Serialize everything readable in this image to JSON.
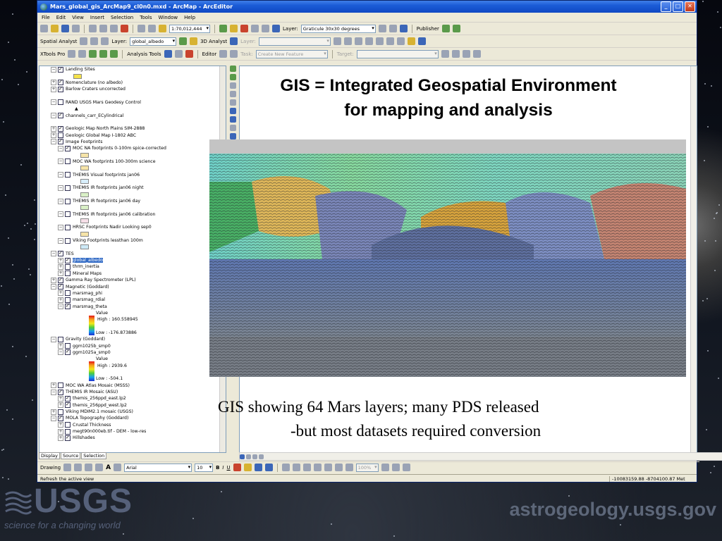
{
  "window": {
    "title": "Mars_global_gis_ArcMap9_cl0n0.mxd - ArcMap - ArcEditor",
    "controls": [
      "_",
      "□",
      "✕"
    ]
  },
  "menu": [
    "File",
    "Edit",
    "View",
    "Insert",
    "Selection",
    "Tools",
    "Window",
    "Help"
  ],
  "standard_toolbar": {
    "scale": "1:70,012,444",
    "layer_label": "Layer:",
    "layer_value": "Graticule 30x30 degrees",
    "publisher": "Publisher"
  },
  "analysis_toolbar": {
    "spatial_analyst": "Spatial Analyst",
    "layer_label": "Layer:",
    "layer_value": "global_albedo",
    "analyst_3d": "3D Analyst",
    "layer2_label": "Layer:"
  },
  "editor_toolbar": {
    "xtools": "XTools Pro",
    "analysis_tools": "Analysis Tools",
    "editor": "Editor",
    "task_label": "Task:",
    "task_value": "Create New Feature",
    "target_label": "Target:"
  },
  "toc": {
    "rows": [
      {
        "indent": 0,
        "twisty": "−",
        "checked": true,
        "label": "Landing Sites"
      },
      {
        "indent": 0,
        "twisty": "",
        "checked": null,
        "label": "",
        "symbol": "#f5e24a"
      },
      {
        "indent": 0,
        "twisty": "+",
        "checked": true,
        "label": "Nomenclature (no albedo)"
      },
      {
        "indent": 0,
        "twisty": "+",
        "checked": true,
        "label": "Barlow Craters uncorrected"
      },
      {
        "indent": 0,
        "twisty": "",
        "checked": null,
        "label": ""
      },
      {
        "indent": 0,
        "twisty": "−",
        "checked": false,
        "label": "RAND USGS Mars Geodesy Control"
      },
      {
        "indent": 0,
        "twisty": "",
        "checked": null,
        "label": "▲"
      },
      {
        "indent": 0,
        "twisty": "−",
        "checked": true,
        "label": "channels_carr_ECylindrical"
      },
      {
        "indent": 0,
        "twisty": "",
        "checked": null,
        "label": ""
      },
      {
        "indent": 0,
        "twisty": "+",
        "checked": true,
        "label": "Geologic Map North Plains SIM-2888"
      },
      {
        "indent": 0,
        "twisty": "+",
        "checked": false,
        "label": "Geologic Global Map I-1802 ABC"
      },
      {
        "indent": 0,
        "twisty": "−",
        "checked": true,
        "label": "Image Footprints"
      },
      {
        "indent": 1,
        "twisty": "−",
        "checked": true,
        "label": "MOC NA footprints 0-100m spice-corrected"
      },
      {
        "indent": 1,
        "twisty": "",
        "checked": null,
        "label": "",
        "symbol": "#f6e4a8"
      },
      {
        "indent": 1,
        "twisty": "−",
        "checked": false,
        "label": "MOC WA footprints 100-300m science"
      },
      {
        "indent": 1,
        "twisty": "",
        "checked": null,
        "label": "",
        "symbol": "#f6e4a8"
      },
      {
        "indent": 1,
        "twisty": "−",
        "checked": false,
        "label": "THEMIS Visual footprints jan06"
      },
      {
        "indent": 1,
        "twisty": "",
        "checked": null,
        "label": "",
        "symbol": "#d8eefb"
      },
      {
        "indent": 1,
        "twisty": "−",
        "checked": false,
        "label": "THEMIS IR footprints jan06 night"
      },
      {
        "indent": 1,
        "twisty": "",
        "checked": null,
        "label": "",
        "symbol": "#d9f0c6"
      },
      {
        "indent": 1,
        "twisty": "−",
        "checked": false,
        "label": "THEMIS IR footprints jan06 day"
      },
      {
        "indent": 1,
        "twisty": "",
        "checked": null,
        "label": "",
        "symbol": "#d9f0c6"
      },
      {
        "indent": 1,
        "twisty": "−",
        "checked": false,
        "label": "THEMIS IR footprints jan06 calibration"
      },
      {
        "indent": 1,
        "twisty": "",
        "checked": null,
        "label": "",
        "symbol": "#f6dfe8"
      },
      {
        "indent": 1,
        "twisty": "−",
        "checked": false,
        "label": "HRSC Footprints Nadir Looking sep0"
      },
      {
        "indent": 1,
        "twisty": "",
        "checked": null,
        "label": "",
        "symbol": "#f6e4a8"
      },
      {
        "indent": 1,
        "twisty": "−",
        "checked": false,
        "label": "Viking Footprints lessthan 100m"
      },
      {
        "indent": 1,
        "twisty": "",
        "checked": null,
        "label": "",
        "symbol": "#cde9f6"
      },
      {
        "indent": 0,
        "twisty": "−",
        "checked": true,
        "label": "TES"
      },
      {
        "indent": 1,
        "twisty": "+",
        "checked": true,
        "label": "global_albedo",
        "selected": true
      },
      {
        "indent": 1,
        "twisty": "+",
        "checked": false,
        "label": "thrm_inertia"
      },
      {
        "indent": 1,
        "twisty": "+",
        "checked": false,
        "label": "Mineral Maps"
      },
      {
        "indent": 0,
        "twisty": "+",
        "checked": true,
        "label": "Gamma Ray Spectrometer (LPL)"
      },
      {
        "indent": 0,
        "twisty": "−",
        "checked": true,
        "label": "Magnetic (Goddard)"
      },
      {
        "indent": 1,
        "twisty": "+",
        "checked": false,
        "label": "marsmag_phi"
      },
      {
        "indent": 1,
        "twisty": "+",
        "checked": false,
        "label": "marsmag_rdial"
      },
      {
        "indent": 1,
        "twisty": "−",
        "checked": true,
        "label": "marsmag_theta"
      },
      {
        "indent": 2,
        "twisty": "",
        "checked": null,
        "label": "Value"
      },
      {
        "indent": 2,
        "twisty": "",
        "checked": null,
        "label": "High : 160.558945",
        "ramp": true
      },
      {
        "indent": 2,
        "twisty": "",
        "checked": null,
        "label": ""
      },
      {
        "indent": 2,
        "twisty": "",
        "checked": null,
        "label": "Low : -176.873886"
      },
      {
        "indent": 0,
        "twisty": "−",
        "checked": false,
        "label": "Gravity (Goddard)"
      },
      {
        "indent": 1,
        "twisty": "+",
        "checked": false,
        "label": "ggm1025b_smp0"
      },
      {
        "indent": 1,
        "twisty": "−",
        "checked": true,
        "label": "ggm1025a_smp0"
      },
      {
        "indent": 2,
        "twisty": "",
        "checked": null,
        "label": "Value"
      },
      {
        "indent": 2,
        "twisty": "",
        "checked": null,
        "label": "High : 2939.6",
        "ramp": true
      },
      {
        "indent": 2,
        "twisty": "",
        "checked": null,
        "label": ""
      },
      {
        "indent": 2,
        "twisty": "",
        "checked": null,
        "label": "Low : -504.1"
      },
      {
        "indent": 0,
        "twisty": "+",
        "checked": false,
        "label": "MOC WA Atlas Mosaic (MSSS)"
      },
      {
        "indent": 0,
        "twisty": "−",
        "checked": true,
        "label": "THEMIS IR Mosaic (ASU)"
      },
      {
        "indent": 1,
        "twisty": "+",
        "checked": true,
        "label": "themis_256ppd_east.lp2"
      },
      {
        "indent": 1,
        "twisty": "+",
        "checked": true,
        "label": "themis_256ppd_west.lp2"
      },
      {
        "indent": 0,
        "twisty": "+",
        "checked": false,
        "label": "Viking MDIM2.1 mosaic (USGS)"
      },
      {
        "indent": 0,
        "twisty": "−",
        "checked": true,
        "label": "MOLA Topography (Goddard)"
      },
      {
        "indent": 1,
        "twisty": "+",
        "checked": false,
        "label": "Crustal Thickness"
      },
      {
        "indent": 1,
        "twisty": "+",
        "checked": false,
        "label": "megt90n000eb.tif - DEM - low-res"
      },
      {
        "indent": 1,
        "twisty": "+",
        "checked": true,
        "label": "Hillshades"
      }
    ],
    "tabs": [
      "Display",
      "Source",
      "Selection"
    ]
  },
  "slide": {
    "headline_line1": "GIS = Integrated Geospatial Environment",
    "headline_line2": "for mapping and analysis",
    "caption_line1": "GIS showing 64 Mars layers; many PDS released",
    "caption_line2": "-but most datasets required conversion"
  },
  "drawing_toolbar": {
    "drawing": "Drawing",
    "font": "Arial",
    "size": "10",
    "bold": "B",
    "italic": "I",
    "underline": "U",
    "zoom": "100%"
  },
  "status": {
    "message": "Refresh the active view",
    "coords": "-10083159.88 -8704100.87 Met"
  },
  "branding": {
    "logo_text": "USGS",
    "tagline": "science for a changing world",
    "site": "astrogeology.usgs.gov"
  }
}
